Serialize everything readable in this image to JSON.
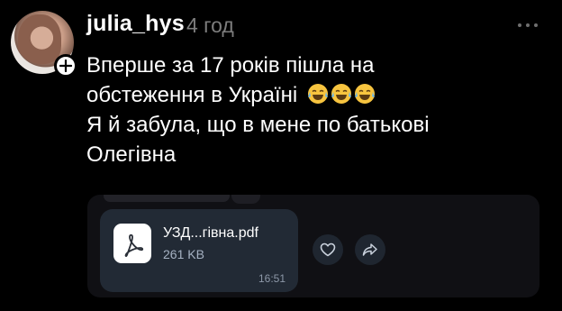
{
  "post": {
    "username": "julia_hys",
    "time": "4 год",
    "lines": [
      "Вперше за 17 років пішла на",
      "обстеження в Україні",
      "Я й забула, що в мене по батькові",
      "Олегівна"
    ],
    "emoji": [
      "joy-emoji",
      "joy-emoji",
      "joy-emoji"
    ]
  },
  "attachment": {
    "file_name": "УЗД...гівна.pdf",
    "file_size": "261 KB",
    "time": "16:51"
  },
  "colors": {
    "background": "#000000",
    "muted": "#7d7d7d",
    "card": "#101014",
    "bubble": "#222a35"
  }
}
